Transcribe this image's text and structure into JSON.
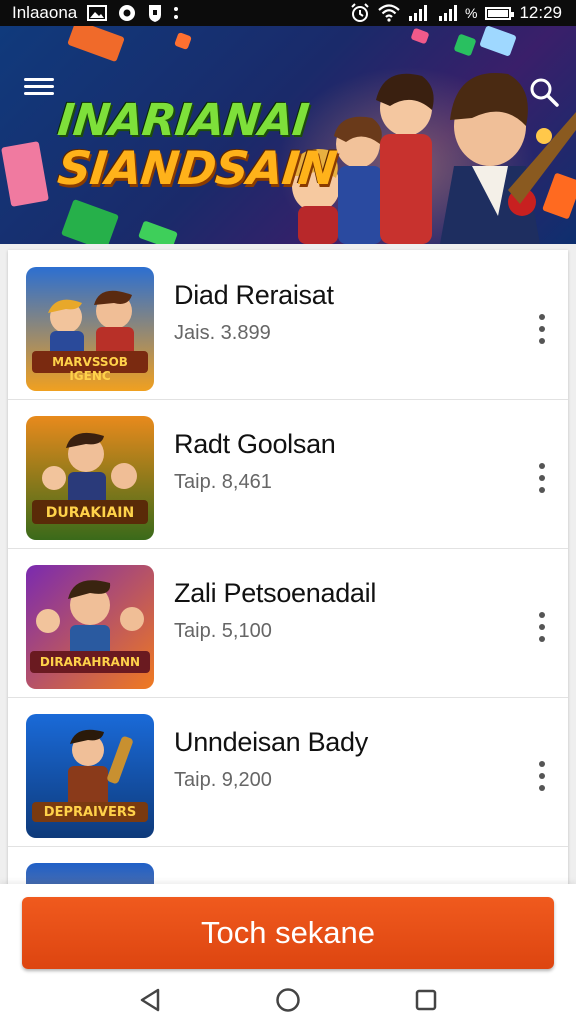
{
  "status_bar": {
    "app_label": "Inlaaona",
    "signal_label": "%",
    "time": "12:29",
    "battery_level": 0.9
  },
  "header": {
    "banner_title_line1": "INARIANAI",
    "banner_title_line2": "SIANDSAIN",
    "menu_icon": "hamburger-menu-icon",
    "search_icon": "search-icon"
  },
  "games": [
    {
      "title": "Diad Reraisat",
      "meta": "Jais. 3.899",
      "thumb_text": "MARVSSOB IGENC",
      "colors": [
        "#2c6fd1",
        "#f0a020"
      ]
    },
    {
      "title": "Radt Goolsan",
      "meta": "Taip. 8,461",
      "thumb_text": "DURAKIAIN",
      "colors": [
        "#e88a1c",
        "#3a6a1a"
      ]
    },
    {
      "title": "Zali Petsoenadail",
      "meta": "Taip. 5,100",
      "thumb_text": "DIRARAHRANN",
      "colors": [
        "#7a2ab0",
        "#f07a20"
      ]
    },
    {
      "title": "Unndeisan Bady",
      "meta": "Taip. 9,200",
      "thumb_text": "DEPRAIVERS",
      "colors": [
        "#1a6ad8",
        "#f0a030"
      ]
    }
  ],
  "cta": {
    "label": "Toch sekane"
  },
  "navigation": {
    "back_icon": "back-triangle-icon",
    "home_icon": "home-circle-icon",
    "recents_icon": "recents-square-icon"
  }
}
